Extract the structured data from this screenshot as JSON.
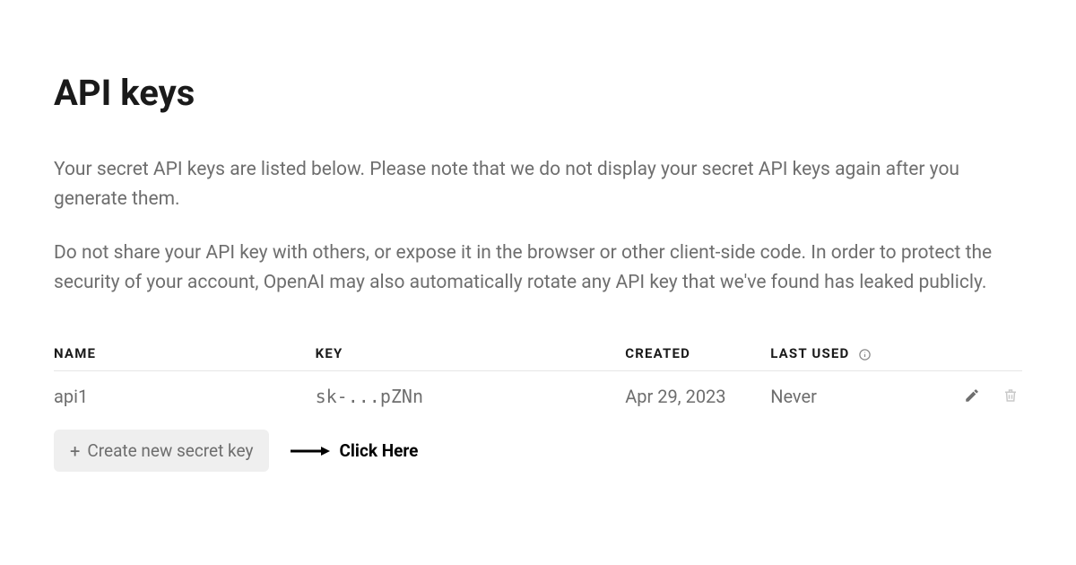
{
  "title": "API keys",
  "description1": "Your secret API keys are listed below. Please note that we do not display your secret API keys again after you generate them.",
  "description2": "Do not share your API key with others, or expose it in the browser or other client-side code. In order to protect the security of your account, OpenAI may also automatically rotate any API key that we've found has leaked publicly.",
  "table": {
    "headers": {
      "name": "NAME",
      "key": "KEY",
      "created": "CREATED",
      "last_used": "LAST USED"
    },
    "rows": [
      {
        "name": "api1",
        "key": "sk-...pZNn",
        "created": "Apr 29, 2023",
        "last_used": "Never"
      }
    ]
  },
  "create_button_label": "Create new secret key",
  "annotation": {
    "label": "Click Here"
  }
}
